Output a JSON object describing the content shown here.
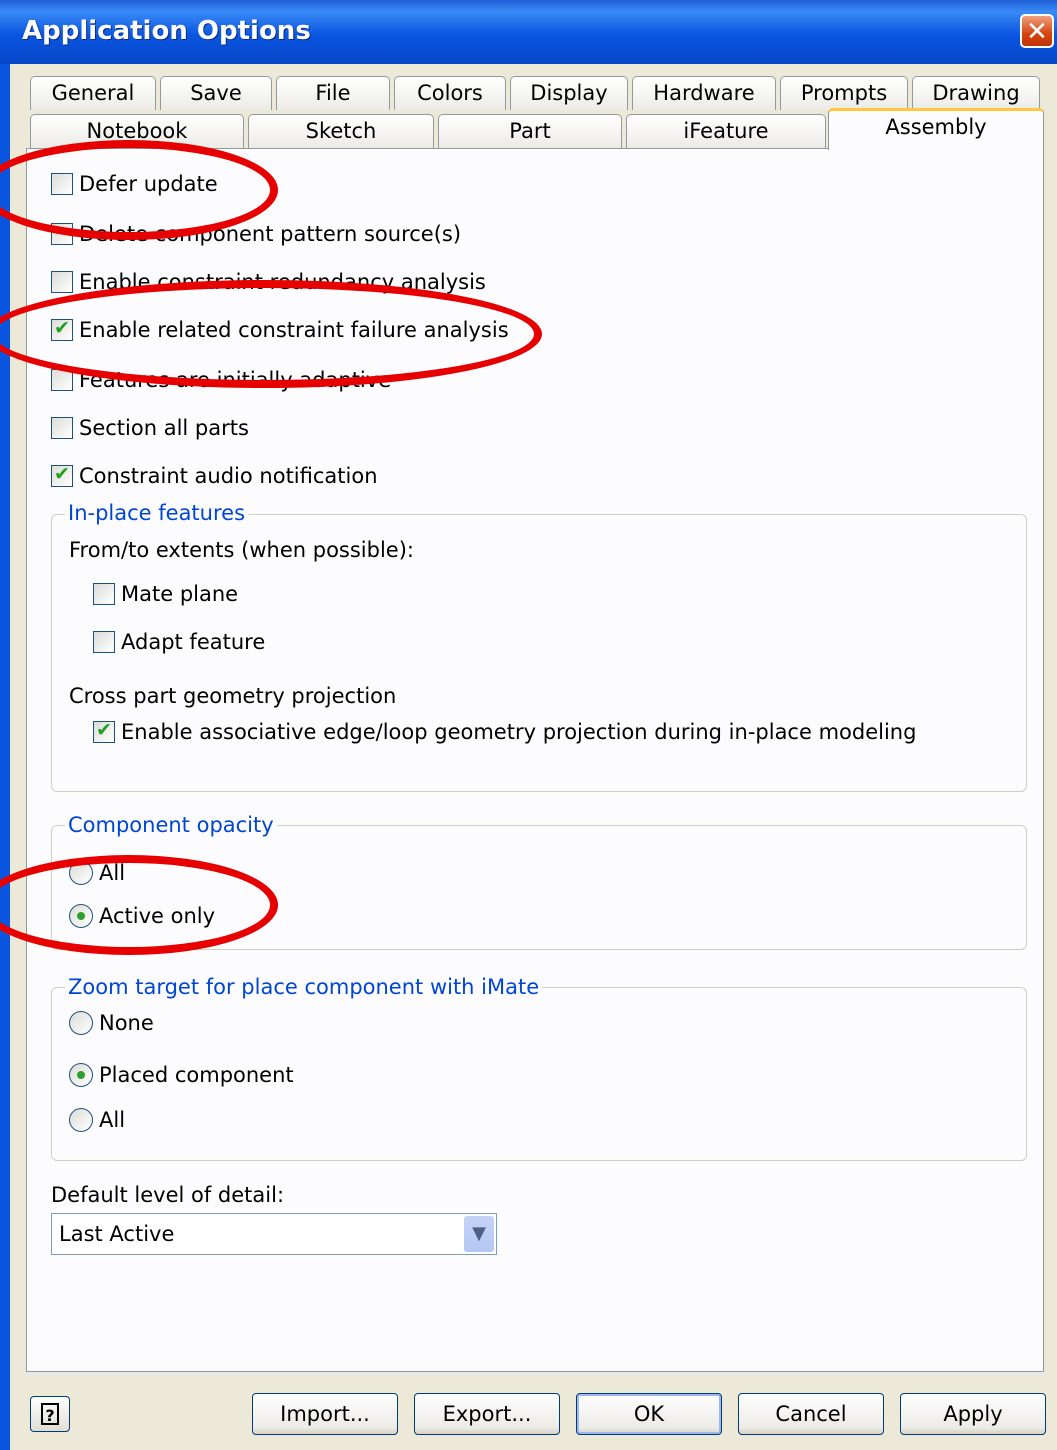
{
  "window": {
    "title": "Application Options",
    "close_glyph": "✕"
  },
  "tabs_row1": [
    "General",
    "Save",
    "File",
    "Colors",
    "Display",
    "Hardware",
    "Prompts",
    "Drawing"
  ],
  "tabs_row2": [
    "Notebook",
    "Sketch",
    "Part",
    "iFeature",
    "Assembly"
  ],
  "active_tab": "Assembly",
  "assembly": {
    "options": [
      {
        "label": "Defer update",
        "checked": false
      },
      {
        "label": "Delete component pattern source(s)",
        "checked": false
      },
      {
        "label": "Enable constraint redundancy analysis",
        "checked": false
      },
      {
        "label": "Enable related constraint failure analysis",
        "checked": true
      },
      {
        "label": "Features are initially adaptive",
        "checked": false
      },
      {
        "label": "Section all parts",
        "checked": false
      },
      {
        "label": "Constraint audio notification",
        "checked": true
      }
    ],
    "inplace": {
      "legend": "In-place features",
      "extents_label": "From/to extents (when possible):",
      "mate_plane": {
        "label": "Mate plane",
        "checked": false
      },
      "adapt_feature": {
        "label": "Adapt feature",
        "checked": false
      },
      "cross_label": "Cross part geometry projection",
      "assoc": {
        "label": "Enable associative edge/loop geometry projection during in-place modeling",
        "checked": true
      }
    },
    "opacity": {
      "legend": "Component opacity",
      "options": [
        "All",
        "Active only"
      ],
      "selected": "Active only"
    },
    "zoom": {
      "legend": "Zoom target for place component with iMate",
      "options": [
        "None",
        "Placed component",
        "All"
      ],
      "selected": "Placed component"
    },
    "lod": {
      "label": "Default level of detail:",
      "value": "Last Active"
    }
  },
  "buttons": {
    "help_glyph": "?",
    "import": "Import...",
    "export": "Export...",
    "ok": "OK",
    "cancel": "Cancel",
    "apply": "Apply"
  },
  "colors": {
    "annotation": "#e60000",
    "title_bar": "#0a55e0",
    "legend": "#0046d5"
  }
}
